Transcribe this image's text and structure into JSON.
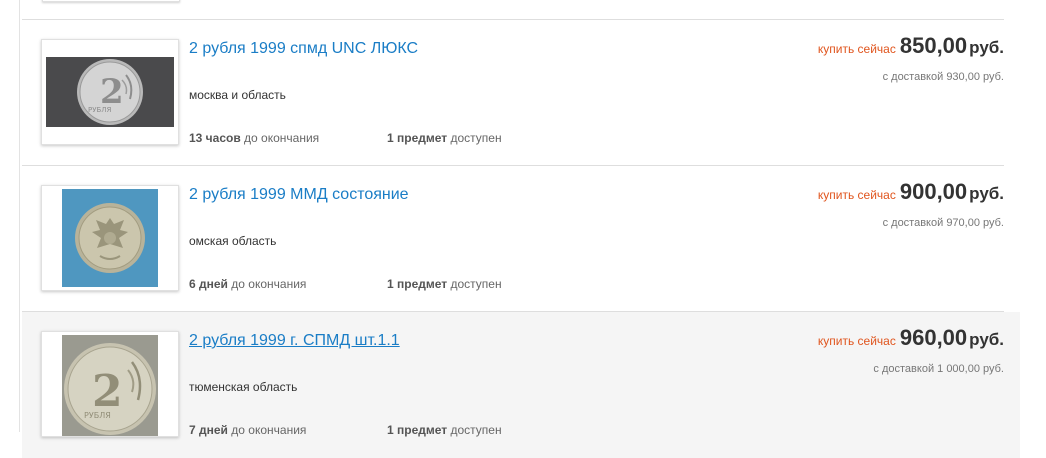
{
  "listings": [
    {
      "title": "2 рубля 1999 спмд UNC ЛЮКС",
      "location": "москва и область",
      "time_value": "13 часов",
      "time_suffix": "до окончания",
      "qty_value": "1 предмет",
      "qty_suffix": "доступен",
      "buy_label": "купить сейчас",
      "price": "850,00",
      "currency": "руб.",
      "shipping": "с доставкой 930,00  руб.",
      "image_icon": "coin-2-rubles-reverse"
    },
    {
      "title": "2 рубля 1999 ММД состояние",
      "location": "омская область",
      "time_value": "6 дней",
      "time_suffix": "до окончания",
      "qty_value": "1 предмет",
      "qty_suffix": "доступен",
      "buy_label": "купить сейчас",
      "price": "900,00",
      "currency": "руб.",
      "shipping": "с доставкой 970,00  руб.",
      "image_icon": "coin-eagle-obverse"
    },
    {
      "title": "2 рубля 1999 г. СПМД шт.1.1",
      "location": "тюменская область",
      "time_value": "7 дней",
      "time_suffix": "до окончания",
      "qty_value": "1 предмет",
      "qty_suffix": "доступен",
      "buy_label": "купить сейчас",
      "price": "960,00",
      "currency": "руб.",
      "shipping": "с доставкой 1 000,00  руб.",
      "image_icon": "coin-2-rubles-reverse"
    }
  ],
  "colors": {
    "link": "#1a7dc6",
    "buy_now": "#e0551e",
    "hover_row": "#f5f5f5"
  }
}
